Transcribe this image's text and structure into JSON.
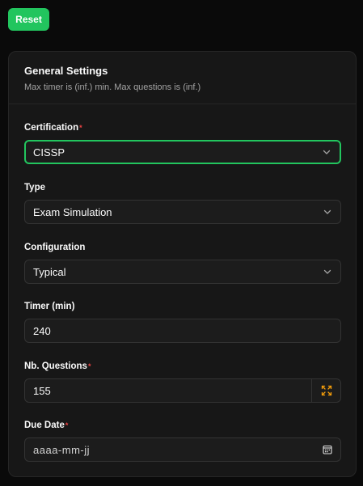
{
  "toolbar": {
    "reset_label": "Reset"
  },
  "settings": {
    "title": "General Settings",
    "description": "Max timer is (inf.) min. Max questions is (inf.)",
    "required_marker": "*",
    "fields": {
      "certification": {
        "label": "Certification",
        "required": true,
        "value": "CISSP"
      },
      "type": {
        "label": "Type",
        "required": false,
        "value": "Exam Simulation"
      },
      "configuration": {
        "label": "Configuration",
        "required": false,
        "value": "Typical"
      },
      "timer": {
        "label": "Timer (min)",
        "required": false,
        "value": "240"
      },
      "questions": {
        "label": "Nb. Questions",
        "required": true,
        "value": "155"
      },
      "due_date": {
        "label": "Due Date",
        "required": true,
        "placeholder": "aaaa-mm-jj"
      }
    }
  },
  "colors": {
    "accent": "#22c55e",
    "required": "#ef4444",
    "expand_icon": "#f59e0b",
    "card_bg": "#171717",
    "page_bg": "#0a0a0a"
  },
  "icons": {
    "select": "chevron-down-icon",
    "questions_addon": "expand-icon",
    "date": "calendar-icon"
  }
}
